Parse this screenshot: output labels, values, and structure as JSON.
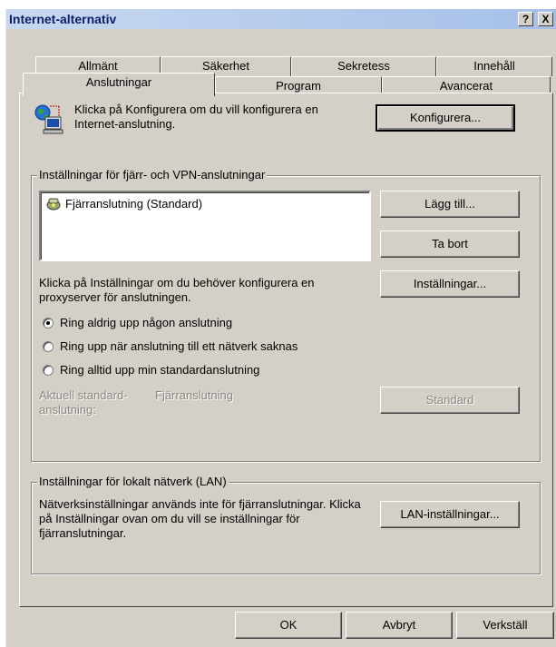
{
  "window": {
    "title": "Internet-alternativ",
    "help_label": "?",
    "close_label": "X"
  },
  "tabs": {
    "row1": [
      "Allmänt",
      "Säkerhet",
      "Sekretess",
      "Innehåll"
    ],
    "row2": [
      "Anslutningar",
      "Program",
      "Avancerat"
    ],
    "active": "Anslutningar"
  },
  "setup": {
    "text": "Klicka på Konfigurera om du vill konfigurera en Internet-anslutning.",
    "icon": "network-computer-icon",
    "button": "Konfigurera..."
  },
  "dialup": {
    "legend": "Inställningar för fjärr- och VPN-anslutningar",
    "connections": [
      "Fjärranslutning (Standard)"
    ],
    "selected_index": 0,
    "add_button": "Lägg till...",
    "remove_button": "Ta bort",
    "proxy_text": "Klicka på Inställningar om du behöver konfigurera en proxyserver för anslutningen.",
    "settings_button": "Inställningar...",
    "radio_options": [
      "Ring aldrig upp någon anslutning",
      "Ring upp när anslutning till ett nätverk saknas",
      "Ring alltid upp min standardanslutning"
    ],
    "selected_radio": 0,
    "default_label": "Aktuell standard-anslutning:",
    "default_value": "Fjärranslutning",
    "default_button": "Standard"
  },
  "lan": {
    "legend": "Inställningar för lokalt nätverk (LAN)",
    "text": "Nätverksinställningar används inte för fjärranslutningar. Klicka på Inställningar ovan om du vill se inställningar för fjärranslutningar.",
    "button": "LAN-inställningar..."
  },
  "footer": {
    "ok": "OK",
    "cancel": "Avbryt",
    "apply": "Verkställ"
  }
}
